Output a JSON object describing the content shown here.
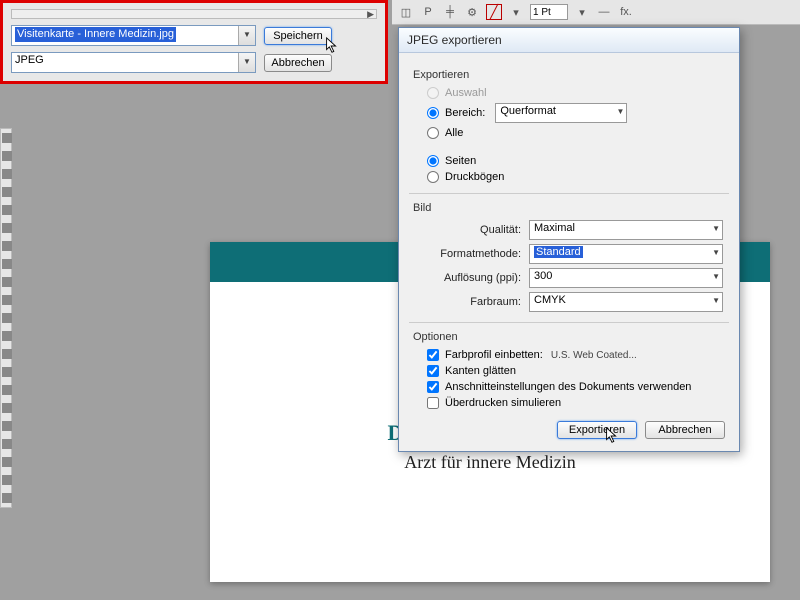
{
  "save_panel": {
    "filename": "Visitenkarte - Innere Medizin.jpg",
    "format": "JPEG",
    "save": "Speichern",
    "cancel": "Abbrechen"
  },
  "toolbar": {
    "stroke": "1 Pt",
    "fx": "fx."
  },
  "card": {
    "name": "Dr. Max Mustermann",
    "sub": "Arzt für innere Medizin"
  },
  "dialog": {
    "title": "JPEG exportieren",
    "export_group": "Exportieren",
    "auswahl": "Auswahl",
    "bereich": "Bereich:",
    "bereich_value": "Querformat",
    "alle": "Alle",
    "seiten": "Seiten",
    "druckbogen": "Druckbögen",
    "bild_group": "Bild",
    "qualitat": "Qualität:",
    "qualitat_value": "Maximal",
    "formatmethode": "Formatmethode:",
    "formatmethode_value": "Standard",
    "aufl": "Auflösung (ppi):",
    "aufl_value": "300",
    "farbraum": "Farbraum:",
    "farbraum_value": "CMYK",
    "optionen_group": "Optionen",
    "farbprofil": "Farbprofil einbetten:",
    "farbprofil_detail": "U.S. Web Coated...",
    "kanten": "Kanten glätten",
    "anschnitt": "Anschnitteinstellungen des Dokuments verwenden",
    "uberdrucken": "Überdrucken simulieren",
    "export_btn": "Exportieren",
    "cancel_btn": "Abbrechen"
  }
}
